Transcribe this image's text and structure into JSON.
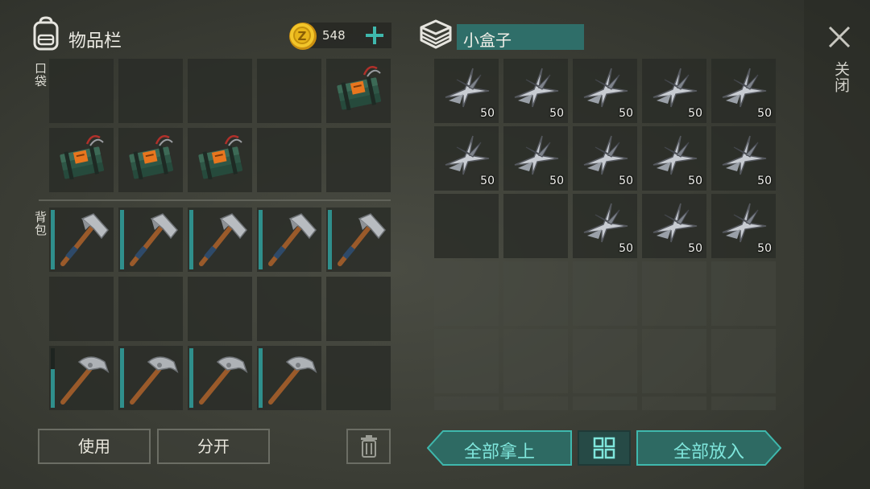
{
  "inventory": {
    "title": "物品栏",
    "pocket_label": "口袋",
    "backpack_label": "背包",
    "coins": "548",
    "add_icon": "plus-icon",
    "pocket_slots": [
      {
        "item": "",
        "count": ""
      },
      {
        "item": "",
        "count": ""
      },
      {
        "item": "",
        "count": ""
      },
      {
        "item": "",
        "count": ""
      },
      {
        "item": "explosive-icon",
        "count": ""
      },
      {
        "item": "explosive-icon",
        "count": ""
      },
      {
        "item": "explosive-icon",
        "count": ""
      },
      {
        "item": "explosive-icon",
        "count": ""
      },
      {
        "item": "",
        "count": ""
      },
      {
        "item": "",
        "count": ""
      }
    ],
    "backpack_slots": [
      {
        "item": "hatchet-icon",
        "durability": 1.0
      },
      {
        "item": "hatchet-icon",
        "durability": 1.0
      },
      {
        "item": "hatchet-icon",
        "durability": 1.0
      },
      {
        "item": "hatchet-icon",
        "durability": 1.0
      },
      {
        "item": "hatchet-icon",
        "durability": 1.0
      },
      {
        "item": "",
        "durability": null
      },
      {
        "item": "",
        "durability": null
      },
      {
        "item": "",
        "durability": null
      },
      {
        "item": "",
        "durability": null
      },
      {
        "item": "",
        "durability": null
      },
      {
        "item": "pickaxe-icon",
        "durability": 0.65
      },
      {
        "item": "pickaxe-icon",
        "durability": 1.0
      },
      {
        "item": "pickaxe-icon",
        "durability": 1.0
      },
      {
        "item": "pickaxe-icon",
        "durability": 1.0
      },
      {
        "item": "",
        "durability": null
      }
    ],
    "use_label": "使用",
    "split_label": "分开",
    "trash_icon": "trash-icon"
  },
  "container": {
    "title": "小盒子",
    "box_icon": "box-icon",
    "slots": [
      {
        "item": "metal-scrap-icon",
        "count": "50"
      },
      {
        "item": "metal-scrap-icon",
        "count": "50"
      },
      {
        "item": "metal-scrap-icon",
        "count": "50"
      },
      {
        "item": "metal-scrap-icon",
        "count": "50"
      },
      {
        "item": "metal-scrap-icon",
        "count": "50"
      },
      {
        "item": "metal-scrap-icon",
        "count": "50"
      },
      {
        "item": "metal-scrap-icon",
        "count": "50"
      },
      {
        "item": "metal-scrap-icon",
        "count": "50"
      },
      {
        "item": "metal-scrap-icon",
        "count": "50"
      },
      {
        "item": "metal-scrap-icon",
        "count": "50"
      },
      {
        "item": "",
        "count": ""
      },
      {
        "item": "",
        "count": ""
      },
      {
        "item": "metal-scrap-icon",
        "count": "50"
      },
      {
        "item": "metal-scrap-icon",
        "count": "50"
      },
      {
        "item": "metal-scrap-icon",
        "count": "50"
      }
    ],
    "take_all_label": "全部拿上",
    "put_all_label": "全部放入",
    "sort_icon": "grid-sort-icon"
  },
  "close": {
    "label": "关闭",
    "icon": "close-icon"
  },
  "colors": {
    "accent_teal": "#2f6e69",
    "bright_teal": "#7fe6dc",
    "coin_gold": "#e8b51a"
  }
}
